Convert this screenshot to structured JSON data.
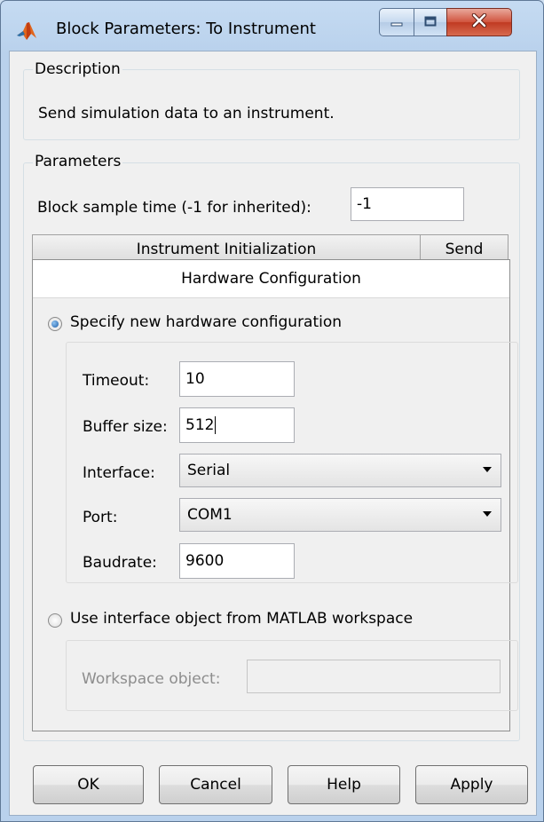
{
  "window": {
    "title": "Block Parameters: To Instrument",
    "icons": {
      "app": "matlab-icon",
      "minimize": "minimize-icon",
      "maximize": "maximize-icon",
      "close": "close-icon"
    }
  },
  "description": {
    "group_label": "Description",
    "text": "Send simulation data to an instrument."
  },
  "parameters": {
    "group_label": "Parameters",
    "sample_time_label": "Block sample time (-1 for inherited):",
    "sample_time_value": "-1",
    "tabs": [
      {
        "label": "Instrument Initialization"
      },
      {
        "label": "Send"
      }
    ]
  },
  "hardware": {
    "header": "Hardware Configuration",
    "option_new_label": "Specify new hardware configuration",
    "option_new_selected": true,
    "timeout_label": "Timeout:",
    "timeout_value": "10",
    "buffer_label": "Buffer size:",
    "buffer_value": "512",
    "interface_label": "Interface:",
    "interface_value": "Serial",
    "port_label": "Port:",
    "port_value": "COM1",
    "baudrate_label": "Baudrate:",
    "baudrate_value": "9600",
    "option_workspace_label": "Use interface object from MATLAB workspace",
    "option_workspace_selected": false,
    "workspace_object_label": "Workspace object:",
    "workspace_object_value": ""
  },
  "buttons": {
    "ok": "OK",
    "cancel": "Cancel",
    "help": "Help",
    "apply": "Apply"
  }
}
